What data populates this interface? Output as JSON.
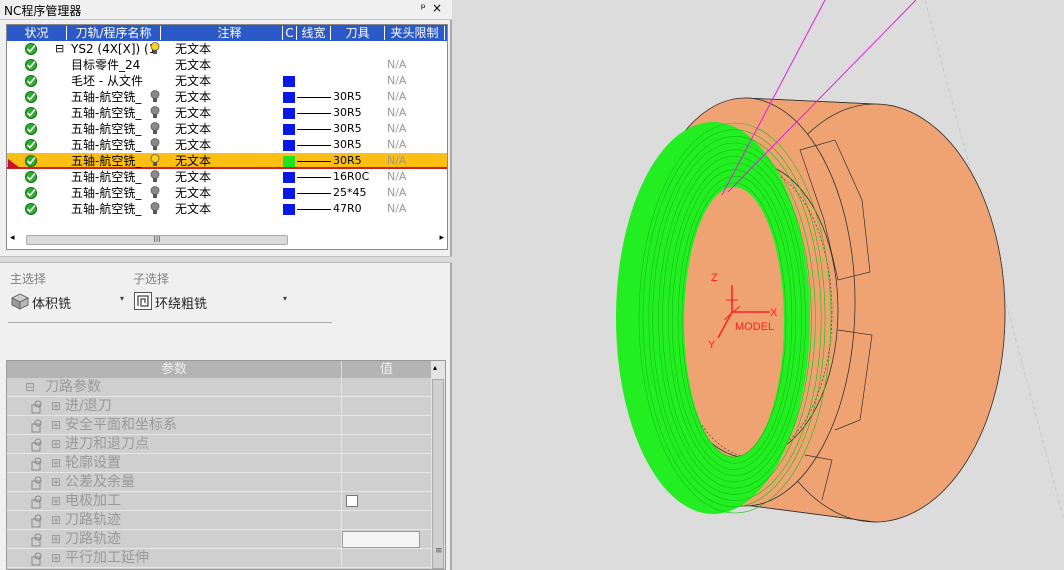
{
  "panel": {
    "title": "NC程序管理器",
    "pin": "ᵖ",
    "close": "×"
  },
  "tree": {
    "columns": [
      "状况",
      "刀轨/程序名称",
      "注释",
      "C",
      "线宽",
      "刀具",
      "夹头限制"
    ],
    "rows": [
      {
        "name": "YS2 (4X[X]) (1",
        "comment": "无文本",
        "color": "",
        "tool": "",
        "limit": "",
        "bulb": "yellow",
        "expander": "⊟"
      },
      {
        "name": "目标零件_24",
        "comment": "无文本",
        "color": "",
        "tool": "",
        "limit": "N/A",
        "bulb": ""
      },
      {
        "name": "毛坯 - 从文件",
        "comment": "无文本",
        "color": "#0b17e6",
        "tool": "",
        "limit": "N/A",
        "bulb": ""
      },
      {
        "name": "五轴-航空铣_",
        "comment": "无文本",
        "color": "#0b17e6",
        "tool": "30R5",
        "limit": "N/A",
        "bulb": "gray"
      },
      {
        "name": "五轴-航空铣_",
        "comment": "无文本",
        "color": "#0b17e6",
        "tool": "30R5",
        "limit": "N/A",
        "bulb": "gray"
      },
      {
        "name": "五轴-航空铣_",
        "comment": "无文本",
        "color": "#0b17e6",
        "tool": "30R5",
        "limit": "N/A",
        "bulb": "gray"
      },
      {
        "name": "五轴-航空铣_",
        "comment": "无文本",
        "color": "#0b17e6",
        "tool": "30R5",
        "limit": "N/A",
        "bulb": "gray"
      },
      {
        "name": "五轴-航空铣_",
        "comment": "无文本",
        "color": "#22e022",
        "tool": "30R5",
        "limit": "N/A",
        "bulb": "yellow",
        "selected": true
      },
      {
        "name": "五轴-航空铣_",
        "comment": "无文本",
        "color": "#0b17e6",
        "tool": "16R0C",
        "limit": "N/A",
        "bulb": "gray"
      },
      {
        "name": "五轴-航空铣_",
        "comment": "无文本",
        "color": "#0b17e6",
        "tool": "25*45",
        "limit": "N/A",
        "bulb": "gray"
      },
      {
        "name": "五轴-航空铣_",
        "comment": "无文本",
        "color": "#0b17e6",
        "tool": "47R0",
        "limit": "N/A",
        "bulb": "gray"
      }
    ],
    "scroll_left": "◂",
    "scroll_right": "▸",
    "scroll_grip": "III"
  },
  "selection": {
    "main_label": "主选择",
    "main_value": "体积铣",
    "sub_label": "子选择",
    "sub_value": "环绕粗铣",
    "arrow": "▾"
  },
  "params": {
    "header_param": "参数",
    "header_value": "值",
    "rows": [
      {
        "label": "刀路参数",
        "indent": 0,
        "expander": "⊟",
        "icon": false,
        "value": ""
      },
      {
        "label": "进/退刀",
        "indent": 1,
        "expander": "⊞",
        "icon": true,
        "value": ""
      },
      {
        "label": "安全平面和坐标系",
        "indent": 1,
        "expander": "⊞",
        "icon": true,
        "value": ""
      },
      {
        "label": "进刀和退刀点",
        "indent": 1,
        "expander": "⊞",
        "icon": true,
        "value": ""
      },
      {
        "label": "轮廓设置",
        "indent": 1,
        "expander": "⊞",
        "icon": true,
        "value": ""
      },
      {
        "label": "公差及余量",
        "indent": 1,
        "expander": "⊞",
        "icon": true,
        "value": ""
      },
      {
        "label": "电极加工",
        "indent": 1,
        "expander": "⊞",
        "icon": true,
        "value": "checkbox"
      },
      {
        "label": "刀路轨迹",
        "indent": 1,
        "expander": "⊞",
        "icon": true,
        "value": ""
      },
      {
        "label": "刀路轨迹",
        "indent": 1,
        "expander": "⊞",
        "icon": true,
        "value": "box"
      },
      {
        "label": "平行加工延伸",
        "indent": 1,
        "expander": "⊞",
        "icon": true,
        "value": ""
      }
    ],
    "scroll_up": "▴",
    "scroll_grip": "≡"
  },
  "viewport": {
    "axis_z": "Z",
    "axis_y": "Y",
    "axis_x": "X",
    "origin_label": "MODEL",
    "part_color": "#efa373",
    "toolpath_color": "#22ee22",
    "axis_color": "#ff2020",
    "tool_axis_color": "#e020e0"
  }
}
